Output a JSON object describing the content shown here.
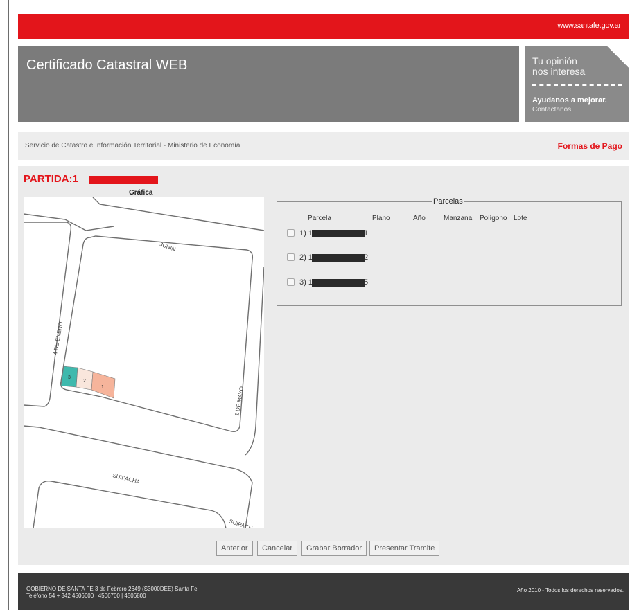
{
  "top_bar": {
    "url": "www.santafe.gov.ar"
  },
  "header": {
    "title": "Certificado Catastral WEB"
  },
  "opinion": {
    "line1": "Tu opinión",
    "line2": "nos interesa",
    "cta": "Ayudanos a mejorar.",
    "contact": "Contactanos"
  },
  "subbar": {
    "service": "Servicio de Catastro e Información Territorial - Ministerio de Economía",
    "payment_link": "Formas de Pago"
  },
  "partida": {
    "label": "PARTIDA:1"
  },
  "grafica": {
    "label": "Gráfica"
  },
  "map": {
    "streets": [
      "JUNIN",
      "4 DE ENERO",
      "1 DE MAYO",
      "SUIPACHA",
      "SUIPACH"
    ],
    "lots": [
      "3",
      "2",
      "1"
    ],
    "colors": {
      "lot3": "#3fb9ad",
      "lot2": "#f9e6dc",
      "lot1": "#f6b49b"
    }
  },
  "parcelas": {
    "legend": "Parcelas",
    "columns": [
      "Parcela",
      "Plano",
      "Año",
      "Manzana",
      "Polígono",
      "Lote"
    ],
    "rows": [
      {
        "prefix": "1) 1",
        "suffix": "1"
      },
      {
        "prefix": "2) 1",
        "suffix": "2"
      },
      {
        "prefix": "3) 1",
        "suffix": "5"
      }
    ]
  },
  "buttons": {
    "anterior": "Anterior",
    "cancelar": "Cancelar",
    "grabar": "Grabar Borrador",
    "presentar": "Presentar Tramite"
  },
  "footer": {
    "line1": "GOBIERNO DE SANTA FE 3 de Febrero 2649 (S3000DEE) Santa Fe",
    "line2": "Teléfono 54 + 342 4506600 | 4506700 | 4506800",
    "copyright": "Año 2010 - Todos los derechos reservados."
  },
  "colors": {
    "brand_red": "#e3151b",
    "header_gray": "#7b7b7b",
    "footer_dark": "#393939"
  }
}
